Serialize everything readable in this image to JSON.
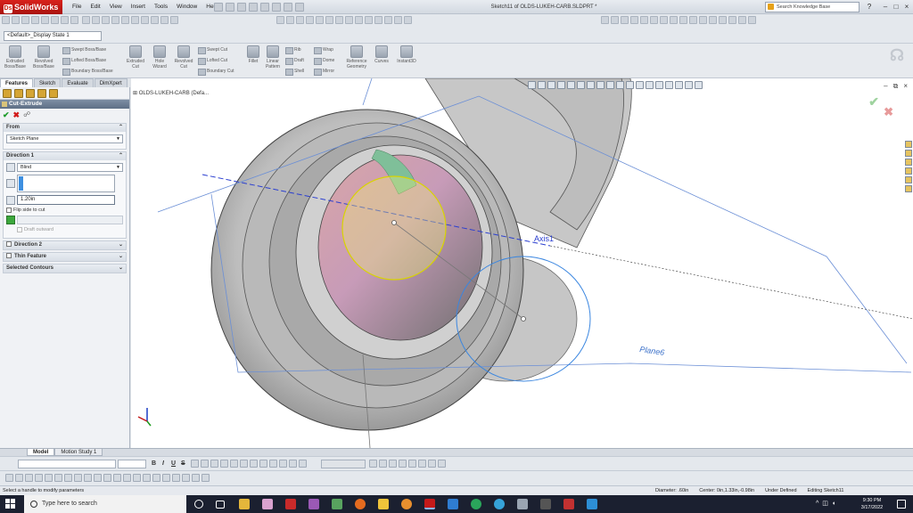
{
  "app": {
    "name": "SolidWorks",
    "document_title": "Sketch11 of OLDS-LUKEH-CARB.SLDPRT *",
    "menu": [
      "File",
      "Edit",
      "View",
      "Insert",
      "Tools",
      "Window",
      "Help"
    ],
    "search_placeholder": "Search Knowledge Base",
    "help_label": "?"
  },
  "config": {
    "display_state": "<Default>_Display State 1"
  },
  "command_manager": {
    "large": [
      {
        "label": "Extruded Boss/Base"
      },
      {
        "label": "Revolved Boss/Base"
      },
      {
        "label": "Extruded Cut"
      },
      {
        "label": "Hole Wizard"
      },
      {
        "label": "Revolved Cut"
      },
      {
        "label": "Fillet"
      },
      {
        "label": "Linear Pattern"
      },
      {
        "label": "Reference Geometry"
      },
      {
        "label": "Curves"
      },
      {
        "label": "Instant3D"
      }
    ],
    "small": [
      "Swept Boss/Base",
      "Lofted Boss/Base",
      "Boundary Boss/Base",
      "Swept Cut",
      "Lofted Cut",
      "Boundary Cut",
      "Rib",
      "Draft",
      "Shell",
      "Wrap",
      "Dome",
      "Mirror"
    ]
  },
  "tabs": [
    "Features",
    "Sketch",
    "Evaluate",
    "DimXpert"
  ],
  "property_manager": {
    "title": "Cut-Extrude",
    "ok": "✔",
    "cancel": "✖",
    "pin": "☍",
    "from": {
      "header": "From",
      "value": "Sketch Plane"
    },
    "direction1": {
      "header": "Direction 1",
      "end_condition": "Blind",
      "depth": "1.20in",
      "flip_label": "Flip side to cut",
      "draft_label": "Draft outward"
    },
    "direction2": {
      "header": "Direction 2"
    },
    "thin_feature": {
      "header": "Thin Feature"
    },
    "selected_contours": {
      "header": "Selected Contours"
    }
  },
  "viewport": {
    "tree_root": "OLDS-LUKEH-CARB (Defa...",
    "axis_label": "Axis1",
    "plane_label": "Plane6"
  },
  "bottom_tabs": [
    "Model",
    "Motion Study 1"
  ],
  "status": {
    "message": "Select a handle to modify parameters",
    "diameter": "Diameter: .60in",
    "center": "Center: 0in,1.33in,-0.98in",
    "defined": "Under Defined",
    "editing": "Editing Sketch11"
  },
  "taskbar": {
    "search_placeholder": "Type here to search",
    "time": "9:30 PM",
    "date": "3/17/2022"
  },
  "colors": {
    "accent_red": "#c8201a",
    "viewport_bg": "#ffffff",
    "sketch_blue": "#2f6fd1",
    "sketch_yellow": "#d9d400"
  }
}
